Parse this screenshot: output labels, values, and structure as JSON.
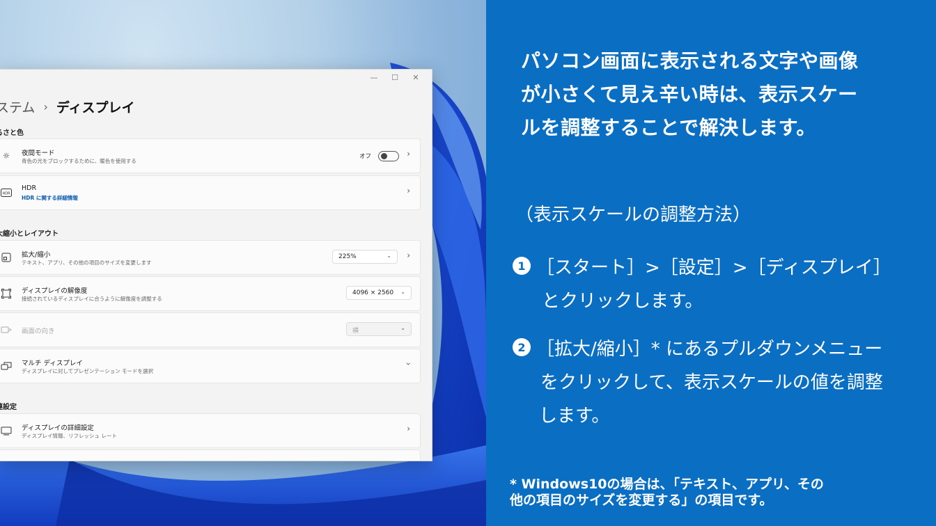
{
  "window": {
    "breadcrumb_parent": "ステム",
    "breadcrumb_sep": "›",
    "breadcrumb_current": "ディスプレイ",
    "controls": {
      "minimize": "—",
      "maximize": "☐",
      "close": "✕"
    }
  },
  "sections": {
    "brightness": "るさと色",
    "scale_layout": "大縮小とレイアウト",
    "related": "連設定"
  },
  "rows": {
    "night_light": {
      "title": "夜間モード",
      "subtitle": "青色の光をブロックするために、暖色を使用する",
      "toggle_label": "オフ",
      "icon": "sun-icon"
    },
    "hdr": {
      "title": "HDR",
      "subtitle": "HDR に関する詳細情報",
      "icon": "hdr-icon"
    },
    "scale": {
      "title": "拡大/縮小",
      "subtitle": "テキスト、アプリ、その他の項目のサイズを変更します",
      "value": "225%",
      "icon": "scale-icon"
    },
    "resolution": {
      "title": "ディスプレイの解像度",
      "subtitle": "接続されているディスプレイに合うように解像度を調整する",
      "value": "4096 × 2560",
      "icon": "resolution-icon"
    },
    "orientation": {
      "title": "画面の向き",
      "value": "横",
      "icon": "orientation-icon"
    },
    "multi": {
      "title": "マルチ ディスプレイ",
      "subtitle": "ディスプレイに対してプレゼンテーション モードを選択",
      "icon": "multi-display-icon"
    },
    "advanced": {
      "title": "ディスプレイの詳細設定",
      "subtitle": "ディスプレイ情報、リフレッシュ レート",
      "icon": "monitor-icon"
    }
  },
  "panel": {
    "intro": [
      "パソコン画面に表示される文字や画像",
      "が小さくて見え辛い時は、表示スケー",
      "ルを調整することで解決します。"
    ],
    "heading": "（表示スケールの調整方法）",
    "step1_num": "1",
    "step1": [
      "［スタート］>［設定］>［ディスプレイ］",
      "とクリックします。"
    ],
    "step2_num": "2",
    "step2": [
      "［拡大/縮小］* にあるプルダウンメニュー",
      "をクリックして、表示スケールの値を調整",
      "します。"
    ],
    "note": [
      "* Windows10の場合は、「テキスト、アプリ、その",
      "他の項目のサイズを変更する」の項目です。"
    ]
  },
  "colors": {
    "panel_bg": "#0a6fc2",
    "link": "#0a5bb5"
  }
}
